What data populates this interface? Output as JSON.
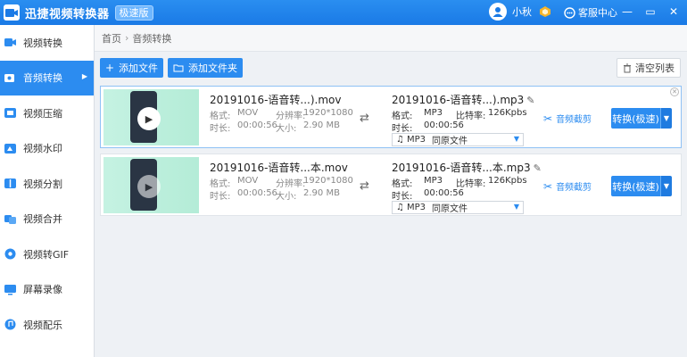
{
  "app": {
    "title": "迅捷视频转换器",
    "badge": "极速版",
    "username": "小秋",
    "service": "客服中心"
  },
  "window": {
    "minimize": "—",
    "restore": "▭",
    "close": "✕"
  },
  "sidebar": {
    "items": [
      {
        "label": "视频转换",
        "icon": "video-convert-icon"
      },
      {
        "label": "音频转换",
        "icon": "audio-convert-icon",
        "active": true
      },
      {
        "label": "视频压缩",
        "icon": "compress-icon"
      },
      {
        "label": "视频水印",
        "icon": "watermark-icon"
      },
      {
        "label": "视频分割",
        "icon": "split-icon"
      },
      {
        "label": "视频合并",
        "icon": "merge-icon"
      },
      {
        "label": "视频转GIF",
        "icon": "gif-icon"
      },
      {
        "label": "屏幕录像",
        "icon": "screen-record-icon"
      },
      {
        "label": "视频配乐",
        "icon": "music-icon"
      }
    ]
  },
  "breadcrumb": {
    "home": "首页",
    "sep": "›",
    "current": "音频转换"
  },
  "toolbar": {
    "add_file": "添加文件",
    "add_folder": "添加文件夹",
    "clear_list": "清空列表"
  },
  "labels": {
    "format": "格式:",
    "resolution": "分辨率:",
    "duration": "时长:",
    "size": "大小:",
    "bitrate": "比特率:",
    "trim": "音频截剪",
    "convert": "转换(极速)"
  },
  "files": [
    {
      "src_name": "20191016-语音转...).mov",
      "src_format": "MOV",
      "src_resolution": "1920*1080",
      "src_duration": "00:00:56",
      "src_size": "2.90 MB",
      "out_name": "20191016-语音转...).mp3",
      "out_format": "MP3",
      "out_bitrate": "126Kpbs",
      "out_duration": "00:00:56",
      "select_format": "MP3",
      "select_quality": "同原文件"
    },
    {
      "src_name": "20191016-语音转...本.mov",
      "src_format": "MOV",
      "src_resolution": "1920*1080",
      "src_duration": "00:00:56",
      "src_size": "2.90 MB",
      "out_name": "20191016-语音转...本.mp3",
      "out_format": "MP3",
      "out_bitrate": "126Kpbs",
      "out_duration": "00:00:56",
      "select_format": "MP3",
      "select_quality": "同原文件"
    }
  ],
  "colors": {
    "accent": "#2c8cf0",
    "titlebar": "#1a7ae6"
  }
}
